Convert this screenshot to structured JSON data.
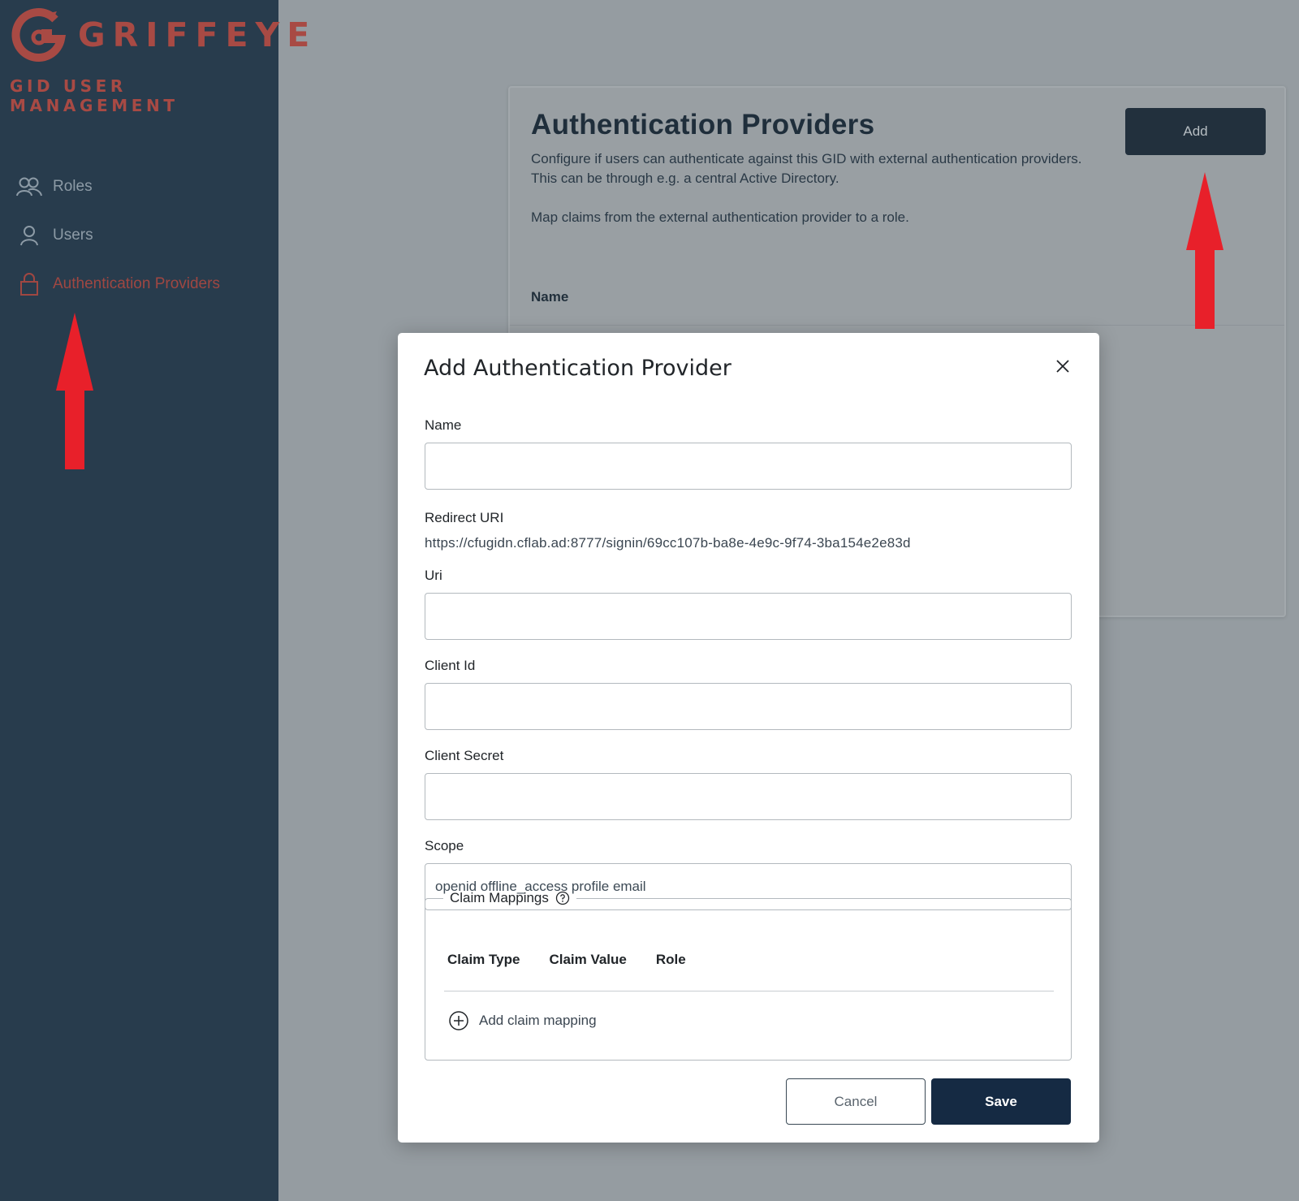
{
  "brand": {
    "name": "GRIFFEYE",
    "subtitle": "GID USER MANAGEMENT",
    "color": "#a84a44"
  },
  "sidebar": {
    "items": [
      {
        "label": "Roles",
        "icon": "roles-icon",
        "active": false
      },
      {
        "label": "Users",
        "icon": "user-icon",
        "active": false
      },
      {
        "label": "Authentication Providers",
        "icon": "lock-icon",
        "active": true
      }
    ]
  },
  "page": {
    "title": "Authentication Providers",
    "description_lines": [
      "Configure if users can authenticate against this GID with external authentication providers.",
      "This can be through e.g. a central Active Directory.",
      "Map claims from the external authentication provider to a role."
    ],
    "add_label": "Add",
    "table_header_name": "Name"
  },
  "modal": {
    "title": "Add Authentication Provider",
    "fields": {
      "name": {
        "label": "Name",
        "value": ""
      },
      "redirect_uri": {
        "label": "Redirect URI",
        "value": "https://cfugidn.cflab.ad:8777/signin/69cc107b-ba8e-4e9c-9f74-3ba154e2e83d"
      },
      "uri": {
        "label": "Uri",
        "value": ""
      },
      "client_id": {
        "label": "Client Id",
        "value": ""
      },
      "client_secret": {
        "label": "Client Secret",
        "value": ""
      },
      "scope": {
        "label": "Scope",
        "value": "openid offline_access profile email"
      }
    },
    "claim_mappings": {
      "legend": "Claim Mappings",
      "columns": [
        "Claim Type",
        "Claim Value",
        "Role"
      ],
      "add_label": "Add claim mapping"
    },
    "cancel_label": "Cancel",
    "save_label": "Save"
  },
  "colors": {
    "sidebar_bg": "#283c4d",
    "primary_button": "#152a43",
    "annotation_arrow": "#e8202a"
  }
}
